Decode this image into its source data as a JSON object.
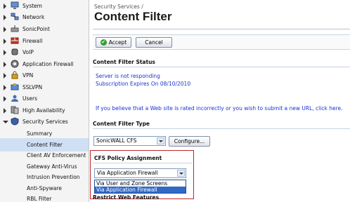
{
  "sidebar": {
    "items": [
      {
        "label": "System",
        "icon": "monitor-icon"
      },
      {
        "label": "Network",
        "icon": "network-icon"
      },
      {
        "label": "SonicPoint",
        "icon": "access-point-icon"
      },
      {
        "label": "Firewall",
        "icon": "firewall-icon"
      },
      {
        "label": "VoIP",
        "icon": "phone-icon"
      },
      {
        "label": "Application Firewall",
        "icon": "app-firewall-icon"
      },
      {
        "label": "VPN",
        "icon": "vpn-lock-icon"
      },
      {
        "label": "SSLVPN",
        "icon": "sslvpn-icon"
      },
      {
        "label": "Users",
        "icon": "users-icon"
      },
      {
        "label": "High Availability",
        "icon": "servers-icon"
      },
      {
        "label": "Security Services",
        "icon": "shield-icon"
      }
    ],
    "subitems": [
      {
        "label": "Summary"
      },
      {
        "label": "Content Filter",
        "selected": true
      },
      {
        "label": "Client AV Enforcement"
      },
      {
        "label": "Gateway Anti-Virus"
      },
      {
        "label": "Intrusion Prevention"
      },
      {
        "label": "Anti-Spyware"
      },
      {
        "label": "RBL Filter"
      }
    ]
  },
  "main": {
    "breadcrumb": "Security Services /",
    "title": "Content Filter",
    "accept_label": "Accept",
    "cancel_label": "Cancel",
    "status_title": "Content Filter Status",
    "status_line1": "Server is not responding",
    "status_line2": "Subscription Expires On 08/10/2010",
    "status_note": "If you believe that a Web site is rated incorrectly or you wish to submit a new URL, click here.",
    "type_title": "Content Filter Type",
    "type_value": "SonicWALL CFS",
    "configure_label": "Configure...",
    "policy_title": "CFS Policy Assignment",
    "policy_value": "Via Application Firewall",
    "policy_options": [
      "Via User and Zone Screens",
      "Via Application Firewall"
    ],
    "restrict_title": "Restrict Web Features"
  },
  "colors": {
    "link_blue": "#1a33cc",
    "highlight_red": "#c0262c",
    "selected_blue": "#3169c6"
  }
}
